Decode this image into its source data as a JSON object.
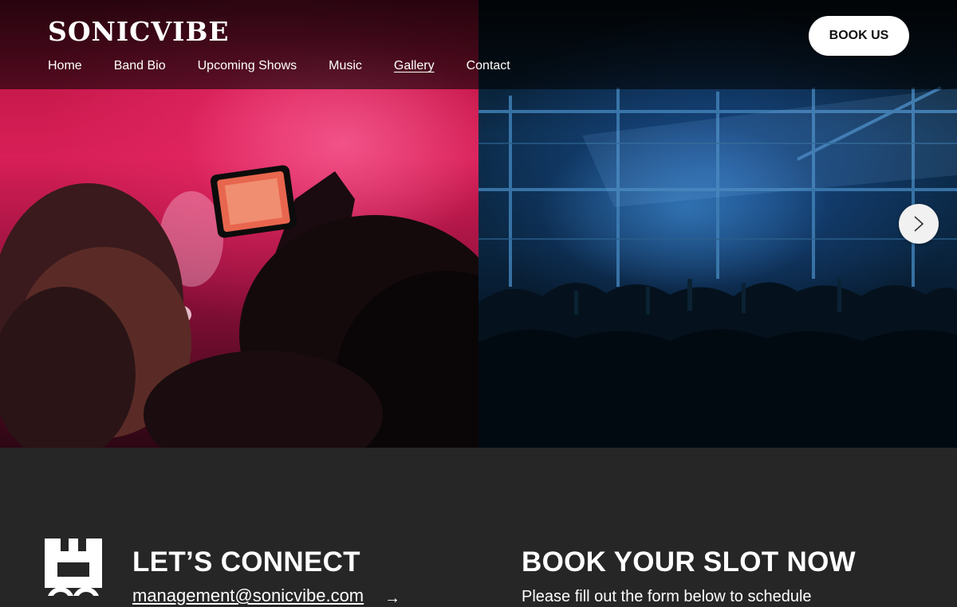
{
  "brand": {
    "logo_text": "SONICVIBE"
  },
  "nav": {
    "items": [
      {
        "label": "Home",
        "active": false
      },
      {
        "label": "Band Bio",
        "active": false
      },
      {
        "label": "Upcoming Shows",
        "active": false
      },
      {
        "label": "Music",
        "active": false
      },
      {
        "label": "Gallery",
        "active": true
      },
      {
        "label": "Contact",
        "active": false
      }
    ]
  },
  "header": {
    "book_button_label": "BOOK US"
  },
  "gallery": {
    "photos": [
      {
        "icon": "concert-phone-photo"
      },
      {
        "icon": "concert-crowd-photo"
      }
    ],
    "next_icon": "chevron-right-icon"
  },
  "connect": {
    "title": "LET’S CONNECT",
    "email": "management@sonicvibe.com",
    "arrow": "→"
  },
  "booking": {
    "title": "BOOK YOUR SLOT NOW",
    "description": "Please fill out the form below to schedule"
  },
  "colors": {
    "background": "#262626",
    "button_bg": "#ffffff",
    "text": "#ffffff"
  }
}
